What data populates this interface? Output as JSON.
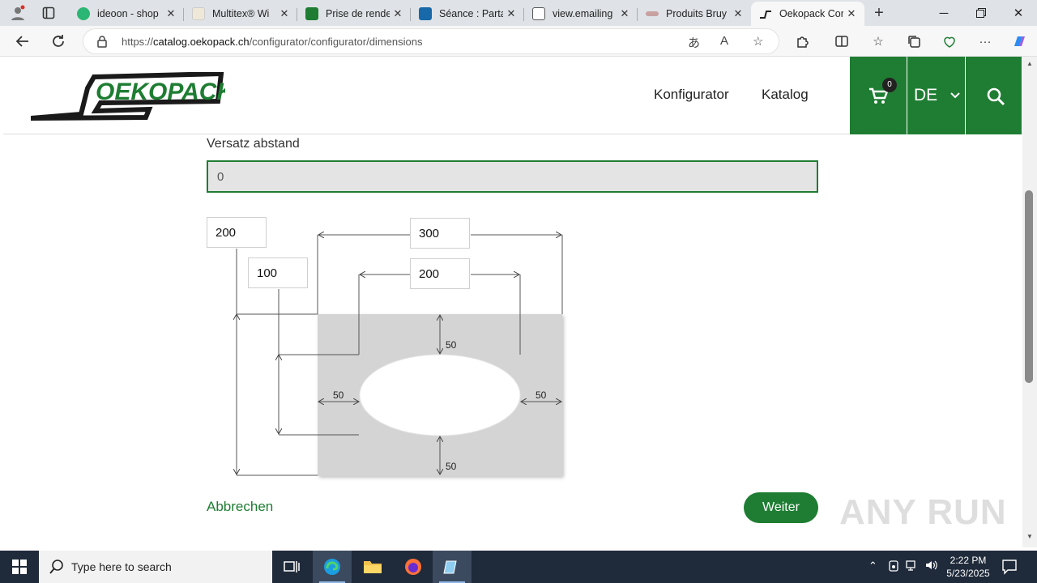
{
  "browser": {
    "tabs": [
      {
        "label": "ideoon - shop",
        "fav_color": "#2bb673"
      },
      {
        "label": "Multitex® Wi",
        "fav_color": "#e8e0d0"
      },
      {
        "label": "Prise de rende",
        "fav_color": "#1e7d32"
      },
      {
        "label": "Séance : Parta",
        "fav_color": "#1769aa"
      },
      {
        "label": "view.emailing",
        "fav_color": "#ffffff"
      },
      {
        "label": "Produits Bruy",
        "fav_color": "#c8a0a0"
      },
      {
        "label": "Oekopack Cor",
        "fav_color": "#333333"
      }
    ],
    "url_prefix": "https://",
    "url_domain": "catalog.oekopack.ch",
    "url_path": "/configurator/configurator/dimensions"
  },
  "header": {
    "logo_text": "OEKOPACK",
    "nav": [
      "Konfigurator",
      "Katalog"
    ],
    "cart_count": "0",
    "language": "DE",
    "brand_color": "#1e7d32"
  },
  "form": {
    "offset_label": "Versatz abstand",
    "offset_value": "0"
  },
  "diagram": {
    "inputs": {
      "total_height": "200",
      "offset_height": "100",
      "total_width": "300",
      "cutout_width": "200"
    },
    "margins": {
      "top": "50",
      "left": "50",
      "right": "50",
      "bottom": "50"
    }
  },
  "actions": {
    "cancel": "Abbrechen",
    "next": "Weiter"
  },
  "watermark": "ANY RUN",
  "taskbar": {
    "search_placeholder": "Type here to search",
    "time": "2:22 PM",
    "date": "5/23/2025"
  }
}
